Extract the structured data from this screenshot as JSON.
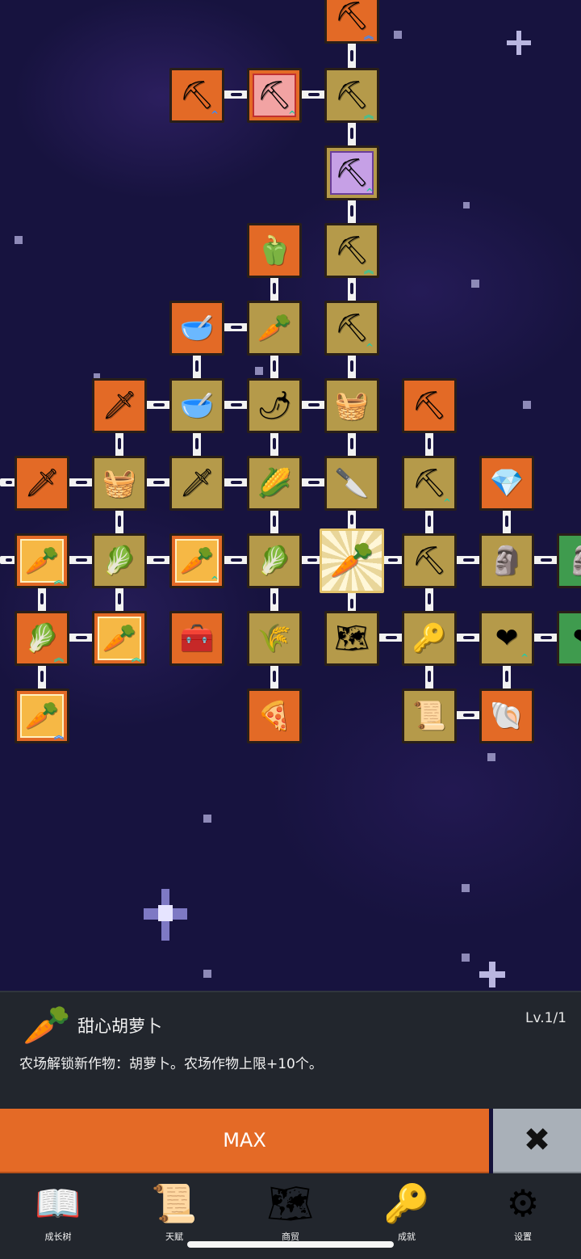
{
  "detail": {
    "icon": "carrot-icon",
    "title": "甜心胡萝卜",
    "level": "Lv.1/1",
    "description": "农场解锁新作物：胡萝卜。农场作物上限+10个。"
  },
  "actions": {
    "max_label": "MAX",
    "close_label": "✖"
  },
  "tabs": [
    {
      "label": "成长树",
      "icon": "book-icon"
    },
    {
      "label": "天赋",
      "icon": "scroll-icon"
    },
    {
      "label": "商贸",
      "icon": "map-icon"
    },
    {
      "label": "成就",
      "icon": "key-icon"
    },
    {
      "label": "设置",
      "icon": "gear-icon"
    }
  ],
  "tree": {
    "selected_node": "carrot",
    "nodes": [
      {
        "id": "shovel-top",
        "icon": "shovel-icon",
        "color": "orange",
        "upgrade": "blue"
      },
      {
        "id": "shovel-a",
        "icon": "shovel-icon",
        "color": "orange",
        "upgrade": "blue"
      },
      {
        "id": "shovel-red",
        "icon": "shovel-icon",
        "color": "orange",
        "frame": "red",
        "upgrade": "teal"
      },
      {
        "id": "shovel-b",
        "icon": "shovel-icon",
        "color": "gold",
        "upgrade": "teal"
      },
      {
        "id": "shovel-purple",
        "icon": "shovel-icon",
        "color": "gold",
        "frame": "purple",
        "upgrade": "teal"
      },
      {
        "id": "pepper",
        "icon": "bell-pepper-icon",
        "color": "orange"
      },
      {
        "id": "shovel-c",
        "icon": "shovel-icon",
        "color": "gold",
        "upgrade": "teal"
      },
      {
        "id": "bowl-a",
        "icon": "bowl-icon",
        "color": "orange"
      },
      {
        "id": "radish",
        "icon": "radish-icon",
        "color": "gold"
      },
      {
        "id": "shovel-d",
        "icon": "shovel-icon",
        "color": "gold",
        "upgrade": "teal"
      },
      {
        "id": "sword-a",
        "icon": "sword-icon",
        "color": "orange"
      },
      {
        "id": "bowl-b",
        "icon": "bowl-icon",
        "color": "gold"
      },
      {
        "id": "chili",
        "icon": "chili-icon",
        "color": "gold"
      },
      {
        "id": "chest-a",
        "icon": "chest-icon",
        "color": "gold"
      },
      {
        "id": "pickaxe-a",
        "icon": "pickaxe-icon",
        "color": "orange"
      },
      {
        "id": "sword-b",
        "icon": "sword-icon",
        "color": "orange"
      },
      {
        "id": "chest-b",
        "icon": "chest-icon",
        "color": "gold"
      },
      {
        "id": "sword-c",
        "icon": "sword-icon",
        "color": "gold"
      },
      {
        "id": "corn",
        "icon": "corn-icon",
        "color": "gold"
      },
      {
        "id": "dagger",
        "icon": "dagger-icon",
        "color": "gold"
      },
      {
        "id": "pickaxe-b",
        "icon": "pickaxe-icon",
        "color": "gold",
        "upgrade": "teal"
      },
      {
        "id": "crystal",
        "icon": "crystal-icon",
        "color": "orange"
      },
      {
        "id": "carrot-a",
        "icon": "carrot-icon",
        "color": "orange",
        "frame": "yellow",
        "upgrade": "teal"
      },
      {
        "id": "cabbage-a",
        "icon": "cabbage-icon",
        "color": "gold"
      },
      {
        "id": "carrot-b",
        "icon": "carrot-icon",
        "color": "orange",
        "frame": "yellow",
        "upgrade": "teal"
      },
      {
        "id": "cabbage-b",
        "icon": "cabbage-icon",
        "color": "gold"
      },
      {
        "id": "carrot",
        "icon": "carrot-icon",
        "color": "selected"
      },
      {
        "id": "pickaxe-c",
        "icon": "pickaxe-icon",
        "color": "gold"
      },
      {
        "id": "statue",
        "icon": "statue-icon",
        "color": "gold"
      },
      {
        "id": "edge-green-a",
        "icon": "statue-icon",
        "color": "green"
      },
      {
        "id": "cabbage-c",
        "icon": "cabbage-icon",
        "color": "orange",
        "upgrade": "teal"
      },
      {
        "id": "carrot-c",
        "icon": "carrot-icon",
        "color": "orange",
        "frame": "yellow",
        "upgrade": "teal"
      },
      {
        "id": "chest-c",
        "icon": "treasure-chest-icon",
        "color": "orange"
      },
      {
        "id": "wheat",
        "icon": "wheat-icon",
        "color": "gold"
      },
      {
        "id": "map",
        "icon": "map-icon",
        "color": "gold"
      },
      {
        "id": "key",
        "icon": "key-icon",
        "color": "gold"
      },
      {
        "id": "heart",
        "icon": "heart-icon",
        "color": "gold",
        "upgrade": "teal"
      },
      {
        "id": "edge-green-b",
        "icon": "heart-icon",
        "color": "green"
      },
      {
        "id": "carrot-d",
        "icon": "carrot-icon",
        "color": "orange",
        "frame": "yellow",
        "upgrade": "blue"
      },
      {
        "id": "pizza",
        "icon": "pizza-icon",
        "color": "orange"
      },
      {
        "id": "scroll",
        "icon": "scroll-icon",
        "color": "gold"
      },
      {
        "id": "fossil",
        "icon": "fossil-icon",
        "color": "orange"
      }
    ]
  }
}
